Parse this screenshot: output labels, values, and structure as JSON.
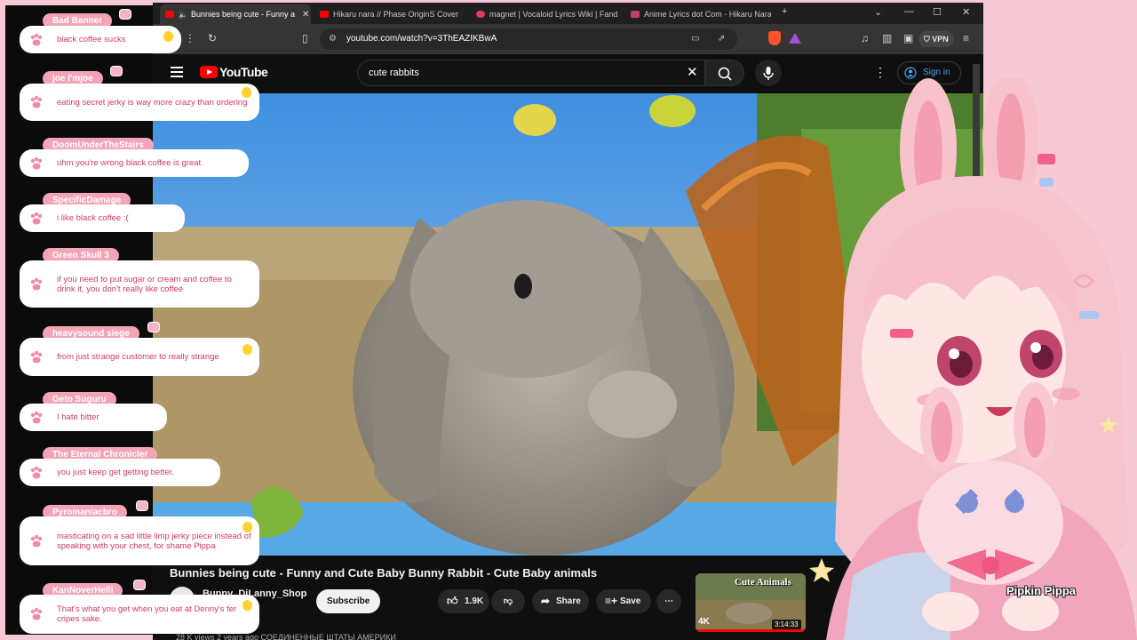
{
  "tabs": [
    {
      "title": "Bunnies being cute - Funny a",
      "active": true,
      "color": "#ff0000"
    },
    {
      "title": "Hikaru nara // Phase OriginS Cover",
      "active": false,
      "color": "#ff0000"
    },
    {
      "title": "magnet | Vocaloid Lyrics Wiki | Fand",
      "active": false,
      "color": "#e23a5a"
    },
    {
      "title": "Anime Lyrics dot Com - Hikaru Nara",
      "active": false,
      "color": "#c0406a"
    }
  ],
  "address": {
    "url": "youtube.com/watch?v=3ThEAZIKBwA",
    "vpn": "VPN"
  },
  "youtube": {
    "logo": "YouTube",
    "search_value": "cute rabbits",
    "sign_in": "Sign in",
    "video_title": "Bunnies being cute - Funny and Cute Baby Bunny Rabbit - Cute Baby animals",
    "channel": "Bunny_DiLanny_Shop",
    "subscribe": "Subscribe",
    "likes": "1.9K",
    "share": "Share",
    "save": "Save",
    "views_line": "28 K views  2 years ago  СОЕДИНЕННЫЕ ШТАТЫ АМЕРИКИ",
    "thumb": {
      "title": "Cute Animals",
      "quality": "4K",
      "duration": "3:14:33"
    }
  },
  "chat": [
    {
      "user": "Bad Banner",
      "message": "black coffee sucks"
    },
    {
      "user": "joe l'mjoe",
      "message": "eating secret jerky is way more crazy than ordering"
    },
    {
      "user": "DoomUnderTheStairs",
      "message": "uhm you're wrong black coffee is great"
    },
    {
      "user": "SpecificDamage",
      "message": "i like black coffee :("
    },
    {
      "user": "Green Skull 3",
      "message": "if you need to put sugar or cream and coffee to drink it, you don't really like coffee"
    },
    {
      "user": "heavysound siege",
      "message": "from just strange customer to really strange"
    },
    {
      "user": "Geto Suguru",
      "message": "I hate bitter"
    },
    {
      "user": "The Eternal Chronicler",
      "message": "you just keep get getting better."
    },
    {
      "user": "Pyromaniacbro",
      "message": "masticating on a sad little limp jerky piece instead of speaking with your chest, for shame Pippa"
    },
    {
      "user": "KanNoverHelli",
      "message": "That's what you get when you eat at Denny's fer cripes sake."
    }
  ],
  "streamer": {
    "name": "Pipkin Pippa"
  },
  "colors": {
    "frame": "#f7c9d4",
    "chat_accent": "#f3a4b6",
    "chat_text": "#d63a5f",
    "yt_red": "#ff0000",
    "link_blue": "#3ea6ff"
  }
}
